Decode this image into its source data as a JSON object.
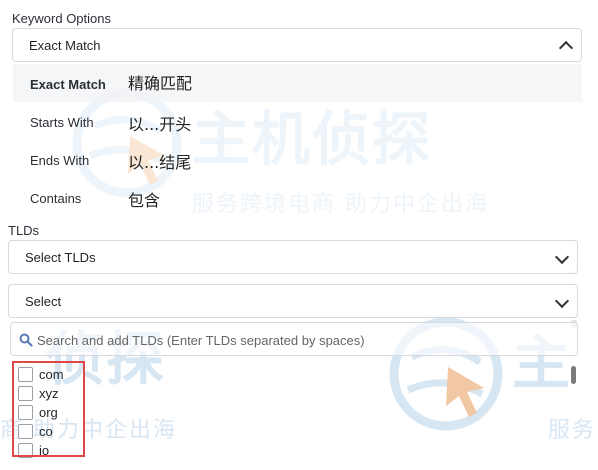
{
  "keyword_options": {
    "label": "Keyword Options",
    "selected": "Exact Match",
    "options": [
      {
        "en": "Exact Match",
        "zh": "精确匹配"
      },
      {
        "en": "Starts With",
        "zh": "以...开头"
      },
      {
        "en": "Ends With",
        "zh": "以...结尾"
      },
      {
        "en": "Contains",
        "zh": "包含"
      }
    ]
  },
  "tlds": {
    "label": "TLDs",
    "select_tlds": "Select TLDs",
    "select": "Select",
    "search_placeholder": "Search and add TLDs (Enter TLDs separated by spaces)",
    "items": [
      "com",
      "xyz",
      "org",
      "co",
      "io"
    ]
  },
  "watermark": {
    "brand": "主机侦探",
    "tagline": "服务跨境电商 助力中企出海",
    "brand_partial": "侦探",
    "tagline_partial": "商 助力中企出海",
    "brand_right": "主",
    "tagline_right": "服务"
  },
  "colors": {
    "highlight_box": "#e04848",
    "watermark": "#d7e6f3",
    "watermark_accent": "#f2c7a3"
  },
  "icons": {
    "dropdown_toggle": "chevron-down-icon",
    "dropdown_open": "chevron-up-icon",
    "search": "search-icon"
  }
}
